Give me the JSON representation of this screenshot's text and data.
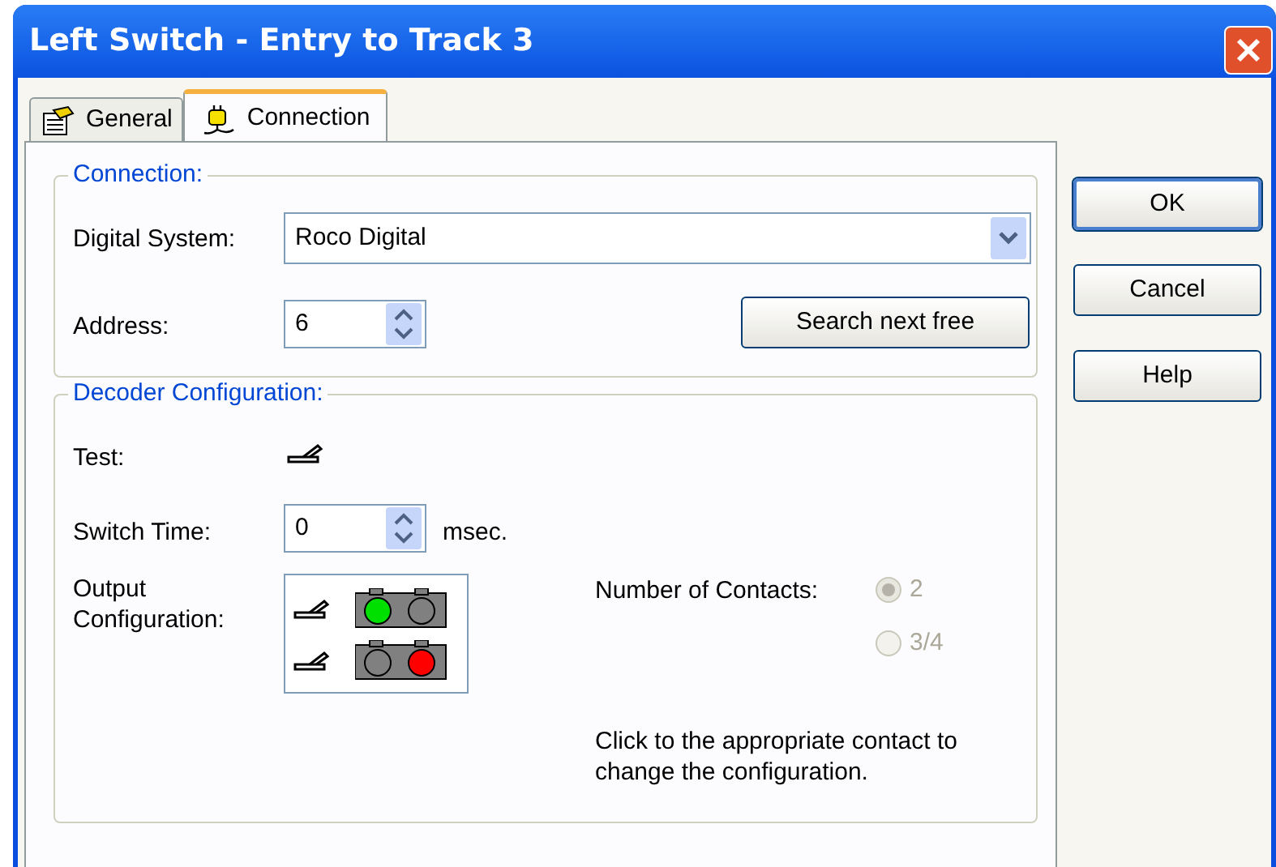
{
  "window": {
    "title": "Left Switch - Entry to Track 3"
  },
  "tabs": [
    {
      "label": "General",
      "selected": false
    },
    {
      "label": "Connection",
      "selected": true
    }
  ],
  "connection": {
    "title": "Connection:",
    "digital_system": {
      "label": "Digital System:",
      "value": "Roco Digital"
    },
    "address": {
      "label": "Address:",
      "value": "6"
    },
    "search_button": "Search next free"
  },
  "decoder": {
    "title": "Decoder Configuration:",
    "test": {
      "label": "Test:"
    },
    "switch_time": {
      "label": "Switch Time:",
      "value": "0",
      "unit": "msec."
    },
    "output": {
      "label": "Output Configuration:",
      "rows": [
        {
          "lamps": [
            {
              "color": "#00e000"
            },
            {
              "color": "#808080"
            }
          ]
        },
        {
          "lamps": [
            {
              "color": "#808080"
            },
            {
              "color": "#ff0000"
            }
          ]
        }
      ]
    },
    "contacts": {
      "label": "Number of Contacts:",
      "disabled": true,
      "options": [
        {
          "label": "2",
          "selected": true
        },
        {
          "label": "3/4",
          "selected": false
        }
      ]
    },
    "hint": "Click to the appropriate contact to change the configuration."
  },
  "buttons": [
    {
      "label": "OK",
      "default": true
    },
    {
      "label": "Cancel",
      "default": false
    },
    {
      "label": "Help",
      "default": false
    }
  ]
}
